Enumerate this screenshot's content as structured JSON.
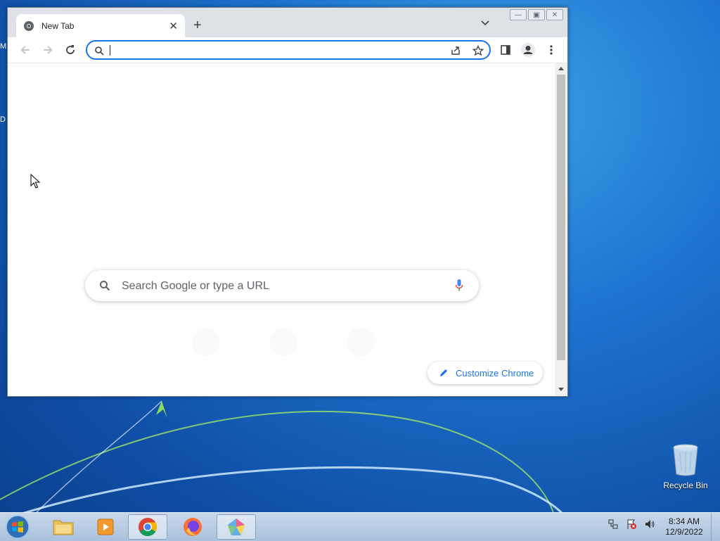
{
  "desktop": {
    "edge_letters": [
      "M",
      "D"
    ],
    "recycle_bin_label": "Recycle Bin"
  },
  "browser": {
    "tab_title": "New Tab",
    "new_tab_symbol": "+",
    "address_value": "",
    "ntp_search_placeholder": "Search Google or type a URL",
    "customize_label": "Customize Chrome",
    "accent_color": "#1a73e8"
  },
  "taskbar": {
    "apps": [
      "windows-explorer",
      "media-player",
      "chrome",
      "firefox",
      "app"
    ],
    "active_app": "chrome",
    "time": "8:34 AM",
    "date": "12/9/2022"
  }
}
